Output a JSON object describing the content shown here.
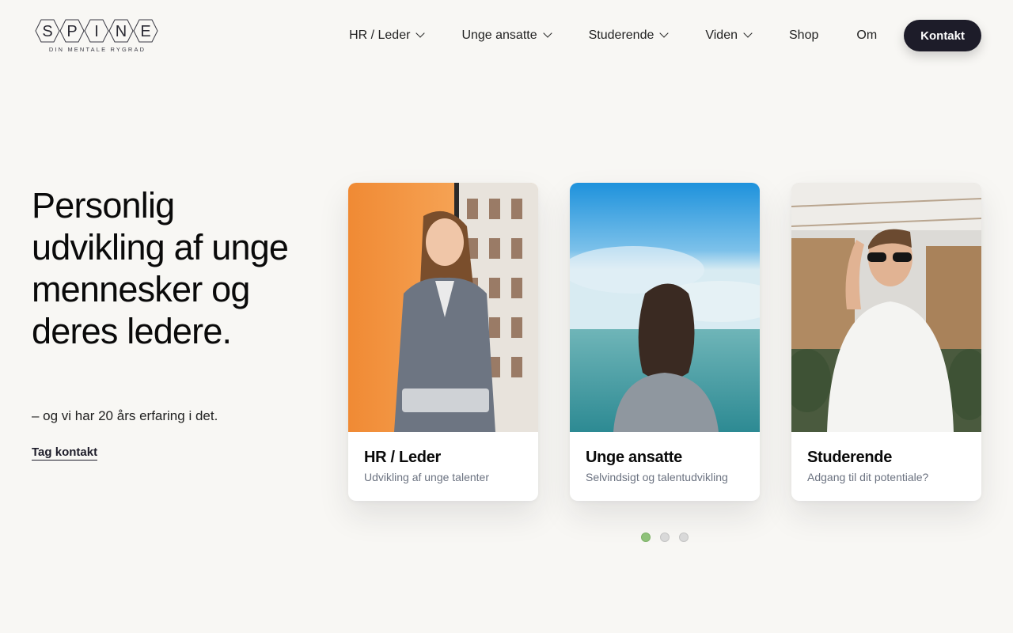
{
  "brand": {
    "name_letters": [
      "S",
      "P",
      "I",
      "N",
      "E"
    ],
    "tagline": "DIN MENTALE RYGRAD"
  },
  "nav": {
    "items": [
      {
        "label": "HR / Leder",
        "has_dropdown": true
      },
      {
        "label": "Unge ansatte",
        "has_dropdown": true
      },
      {
        "label": "Studerende",
        "has_dropdown": true
      },
      {
        "label": "Viden",
        "has_dropdown": true
      },
      {
        "label": "Shop",
        "has_dropdown": false
      },
      {
        "label": "Om",
        "has_dropdown": false
      }
    ],
    "cta_label": "Kontakt"
  },
  "hero": {
    "title": "Personlig udvikling af unge mennesker og deres ledere.",
    "subtitle": "– og vi har 20 års erfaring i det.",
    "link_label": "Tag kontakt"
  },
  "cards": [
    {
      "title": "HR / Leder",
      "description": "Udvikling af unge talenter",
      "photo": "woman-in-blazer-photo"
    },
    {
      "title": "Unge ansatte",
      "description": "Selvindsigt og talentudvikling",
      "photo": "woman-facing-sea-photo"
    },
    {
      "title": "Studerende",
      "description": "Adgang til dit potentiale?",
      "photo": "man-with-sunglasses-photo"
    }
  ],
  "pager": {
    "count": 3,
    "active_index": 0
  },
  "colors": {
    "background": "#f8f7f4",
    "cta_background": "#1d1c29",
    "active_dot": "#8fc27a",
    "card_description": "#6b7280"
  }
}
